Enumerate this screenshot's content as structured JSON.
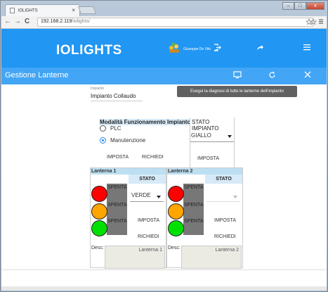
{
  "browser": {
    "tab_title": "IOLIGHTS",
    "tab_close": "×",
    "url_host": "192.168.2.119",
    "url_path": "/iolights/",
    "nav_back": "←",
    "nav_forward": "→",
    "nav_reload": "C",
    "controls": {
      "minimize": "–",
      "maximize": "□",
      "close": "x"
    }
  },
  "appbar": {
    "logo": "IOLIGHTS",
    "user_name": "Giuseppe De Vito"
  },
  "subbar": {
    "title": "Gestione Lanterne",
    "tooltip": "Esegui la diagnosi di tutte le lanterne dell'impianto"
  },
  "plant": {
    "label": "Impianto",
    "value": "Impianto Collaudo"
  },
  "mode": {
    "title": "Modalità Funzionamento Impianto",
    "options": [
      {
        "label": "PLC",
        "selected": false
      },
      {
        "label": "Manutenzione",
        "selected": true
      }
    ],
    "set_label": "IMPOSTA",
    "request_label": "RICHIEDI"
  },
  "plant_state": {
    "title": "STATO IMPIANTO",
    "value": "GIALLO",
    "set_label": "IMPOSTA"
  },
  "lanterns": [
    {
      "name": "Lanterna 1",
      "state_header": "STATO",
      "lamps": [
        {
          "color": "#ff0000",
          "status": "SPENTA"
        },
        {
          "color": "#ffa500",
          "status": "SPENTA"
        },
        {
          "color": "#00e000",
          "status": "SPENTA"
        }
      ],
      "select_value": "VERDE",
      "set_label": "IMPOSTA",
      "request_label": "RICHIEDI",
      "desc_label": "Desc:",
      "desc_value": "Lanterna 1"
    },
    {
      "name": "Lanterna 2",
      "state_header": "STATO",
      "lamps": [
        {
          "color": "#ff0000",
          "status": "SPENTA"
        },
        {
          "color": "#ffa500",
          "status": "SPENTA"
        },
        {
          "color": "#00e000",
          "status": "SPENTA"
        }
      ],
      "select_value": "",
      "set_label": "IMPOSTA",
      "request_label": "RICHIEDI",
      "desc_label": "Desc:",
      "desc_value": "Lanterna 2"
    }
  ],
  "icons": {
    "logout": "logout-icon",
    "share": "share-icon",
    "menu": "menu-icon",
    "diagnose": "monitor-icon",
    "refresh": "refresh-icon",
    "close": "close-icon"
  }
}
